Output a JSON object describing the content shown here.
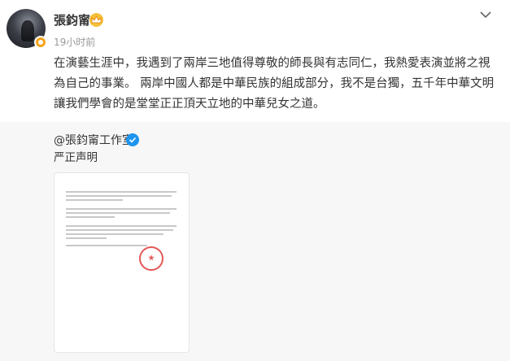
{
  "post": {
    "author_name": "張鈞甯",
    "time": "19小时前",
    "text": "在演藝生涯中，我遇到了兩岸三地值得尊敬的師長與有志同仁，我熱愛表演並將之視為自己的事業。 兩岸中國人都是中華民族的組成部分，我不是台獨，五千年中華文明讓我們學會的是堂堂正正頂天立地的中華兒女之道。"
  },
  "repost": {
    "author": "@張鈞甯工作室",
    "text": "严正声明"
  },
  "colors": {
    "accent": "#f7a21b",
    "verified": "#1d95f0",
    "repost_bg": "#f7f7f7",
    "seal": "#e03c3c"
  }
}
